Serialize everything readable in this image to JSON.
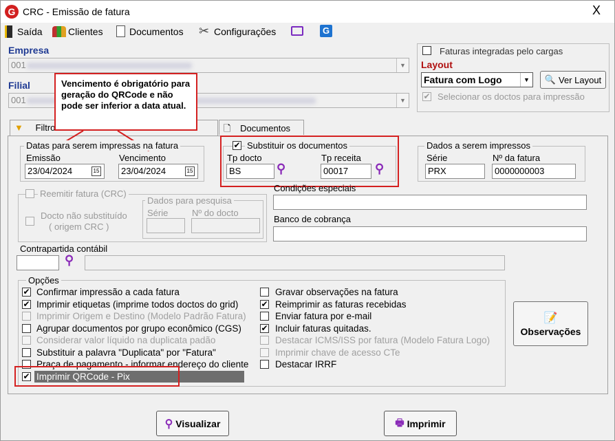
{
  "window": {
    "title": "CRC - Emissão de fatura",
    "close": "X"
  },
  "menu": [
    {
      "label": "Saída"
    },
    {
      "label": "Clientes"
    },
    {
      "label": "Documentos"
    },
    {
      "label": "Configurações"
    }
  ],
  "empresa": {
    "label": "Empresa",
    "value": "001"
  },
  "filial": {
    "label": "Filial",
    "value": "001"
  },
  "tooltip": {
    "text": "Vencimento é obrigatório para geração do QRCode e não pode ser inferior a data atual."
  },
  "right_panel": {
    "faturas_integradas": "Faturas integradas pelo cargas",
    "layout_label": "Layout",
    "layout_value": "Fatura com Logo",
    "ver_layout": "Ver Layout",
    "selecionar": "Selecionar os doctos para impressão"
  },
  "tabs": [
    {
      "label": "Filtros"
    },
    {
      "label": "Documentos"
    }
  ],
  "datas": {
    "group": "Datas para serem impressas na fatura",
    "emissao_label": "Emissão",
    "emissao": "23/04/2024",
    "vencimento_label": "Vencimento",
    "vencimento": "23/04/2024",
    "cal": "15"
  },
  "substituir": {
    "label": "Substituir os documentos",
    "tp_docto_label": "Tp docto",
    "tp_docto": "BS",
    "tp_receita_label": "Tp receita",
    "tp_receita": "00017"
  },
  "dados_impressos": {
    "group": "Dados a serem impressos",
    "serie_label": "Série",
    "serie": "PRX",
    "nfatura_label": "Nº da fatura",
    "nfatura": "0000000003"
  },
  "reemitir": {
    "label": "Reemitir fatura (CRC)",
    "docto_line1": "Docto não substituído",
    "docto_line2": "( origem CRC )",
    "pesquisa_group": "Dados para pesquisa",
    "serie_label": "Série",
    "ndocto_label": "Nº do docto"
  },
  "condicoes": {
    "label": "Condições especiais"
  },
  "banco": {
    "label": "Banco de cobrança"
  },
  "contrapartida": {
    "label": "Contrapartida contábil"
  },
  "opcoes": {
    "group": "Opções",
    "left": [
      {
        "label": "Confirmar impressão a cada fatura",
        "checked": "✔",
        "enabled": true
      },
      {
        "label": "Imprimir etiquetas (imprime todos doctos do grid)",
        "checked": "✔",
        "enabled": true
      },
      {
        "label": "Imprimir Origem e Destino (Modelo Padrão Fatura)",
        "checked": "",
        "enabled": false
      },
      {
        "label": "Agrupar documentos por grupo econômico (CGS)",
        "checked": "",
        "enabled": true
      },
      {
        "label": "Considerar valor líquido na duplicata padão",
        "checked": "",
        "enabled": false
      },
      {
        "label": "Substituir a palavra \"Duplicata\" por \"Fatura\"",
        "checked": "",
        "enabled": true
      },
      {
        "label": "Praça de pagamento - informar endereço do cliente",
        "checked": "",
        "enabled": true
      },
      {
        "label": "Imprimir QRCode - Pix",
        "checked": "✔",
        "enabled": true
      }
    ],
    "right": [
      {
        "label": "Gravar observações na fatura",
        "checked": "",
        "enabled": true
      },
      {
        "label": "Reimprimir as faturas recebidas",
        "checked": "✔",
        "enabled": true
      },
      {
        "label": "Enviar fatura por e-mail",
        "checked": "",
        "enabled": true
      },
      {
        "label": "Incluir faturas quitadas.",
        "checked": "✔",
        "enabled": true
      },
      {
        "label": "Destacar ICMS/ISS por fatura (Modelo Fatura Logo)",
        "checked": "",
        "enabled": false
      },
      {
        "label": "Imprimir chave de acesso CTe",
        "checked": "",
        "enabled": false
      },
      {
        "label": "Destacar IRRF",
        "checked": "",
        "enabled": true
      }
    ]
  },
  "buttons": {
    "observacoes": "Observações",
    "visualizar": "Visualizar",
    "imprimir": "Imprimir"
  },
  "colors": {
    "accent_red": "#d42020",
    "label_blue": "#1f3a93",
    "layout_red": "#b01010",
    "icon_purple": "#8a2bb8"
  }
}
